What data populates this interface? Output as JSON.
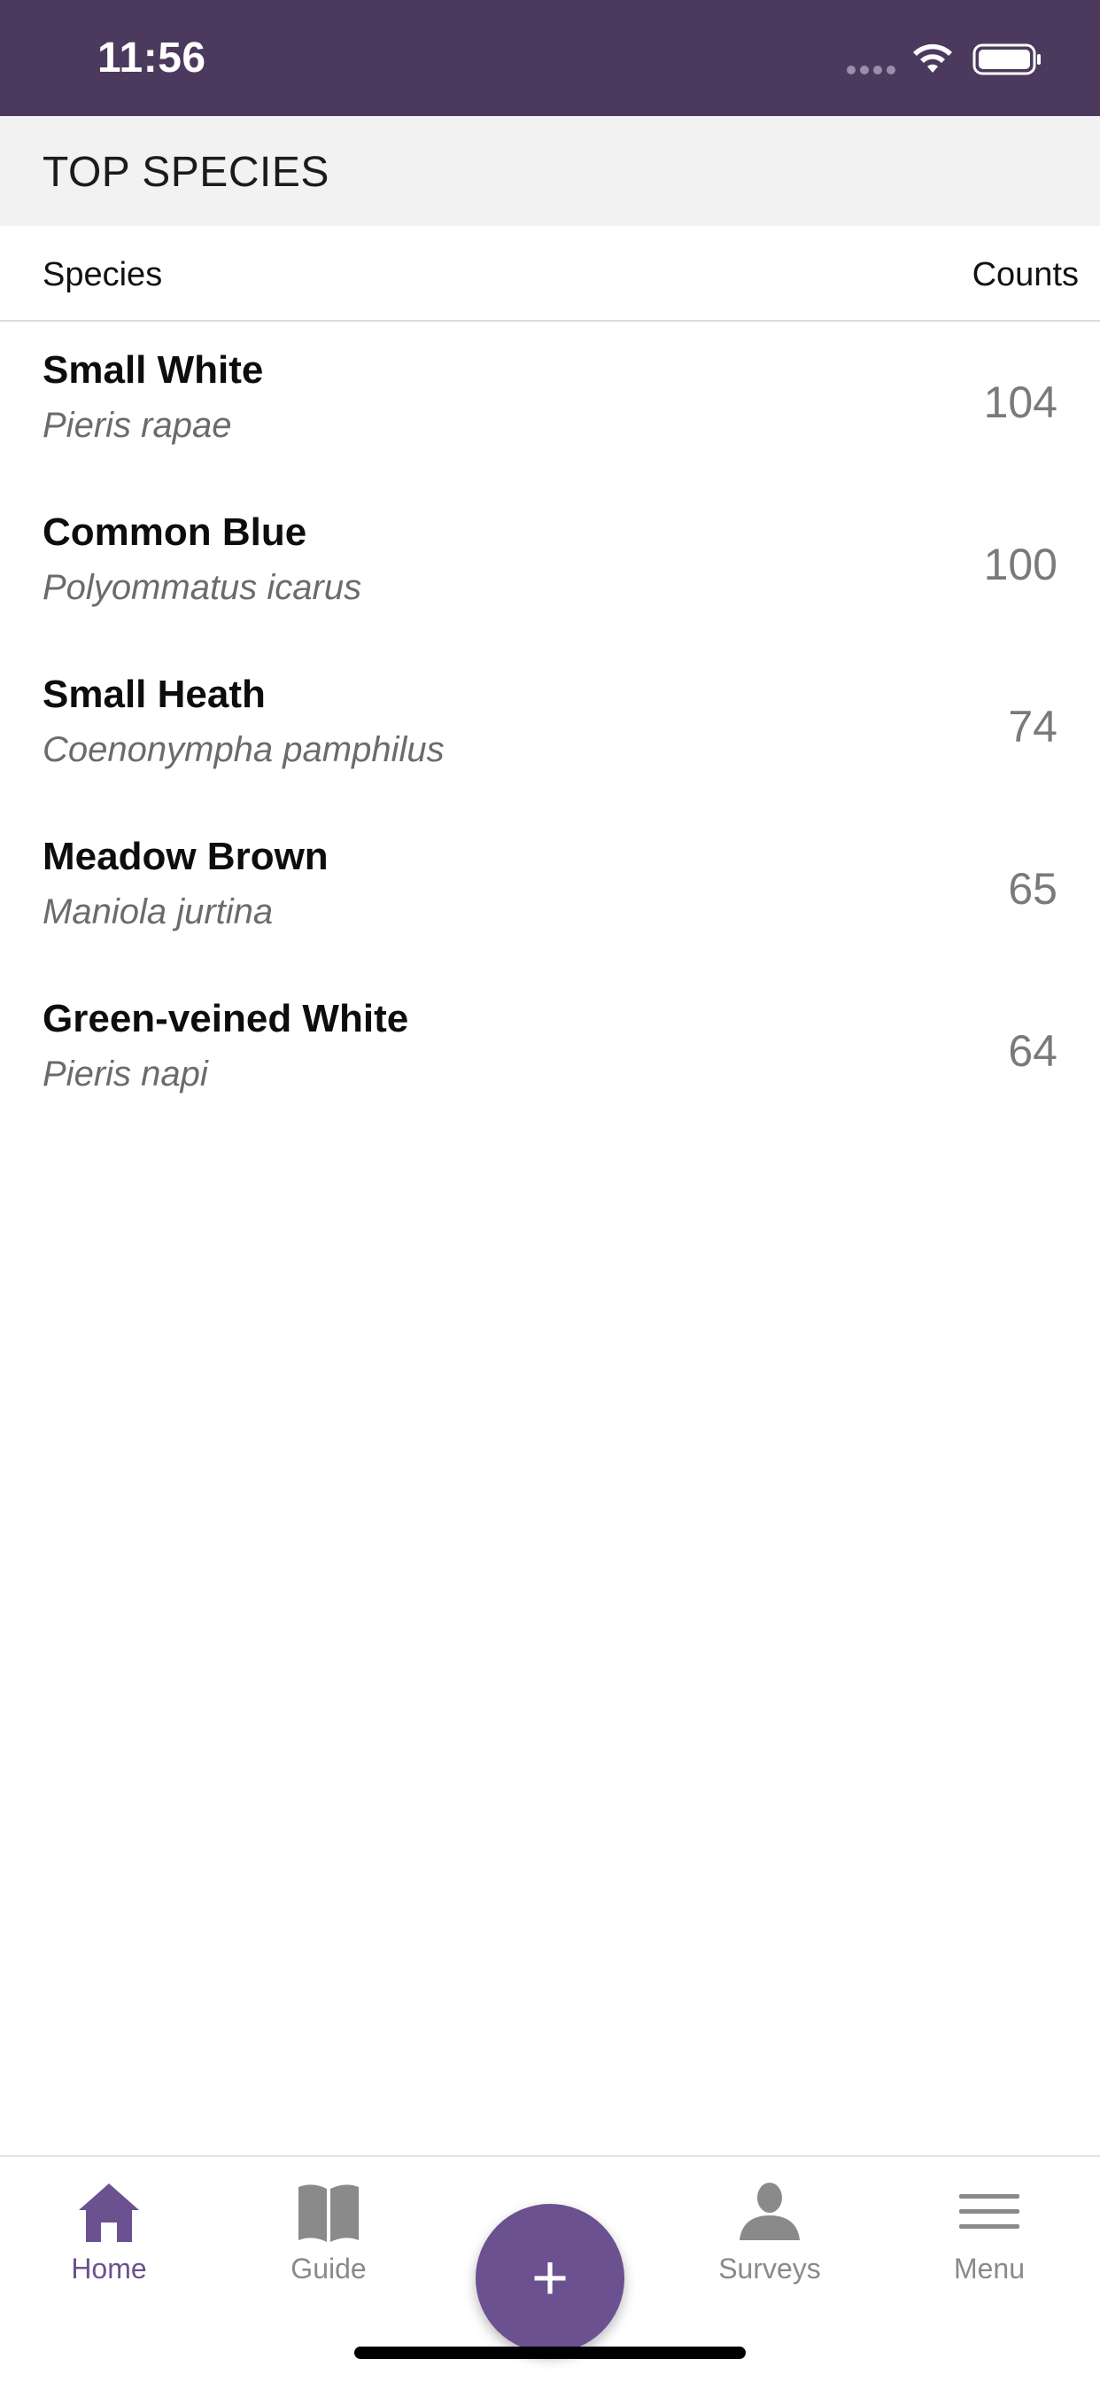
{
  "status_bar": {
    "time": "11:56"
  },
  "section": {
    "title": "TOP SPECIES"
  },
  "columns": {
    "species": "Species",
    "counts": "Counts"
  },
  "species": [
    {
      "name": "Small White",
      "latin": "Pieris rapae",
      "count": "104"
    },
    {
      "name": "Common Blue",
      "latin": "Polyommatus icarus",
      "count": "100"
    },
    {
      "name": "Small Heath",
      "latin": "Coenonympha pamphilus",
      "count": "74"
    },
    {
      "name": "Meadow Brown",
      "latin": "Maniola jurtina",
      "count": "65"
    },
    {
      "name": "Green-veined White",
      "latin": "Pieris napi",
      "count": "64"
    }
  ],
  "tabs": [
    {
      "label": "Home",
      "icon": "home-icon",
      "active": true
    },
    {
      "label": "Guide",
      "icon": "book-icon",
      "active": false
    },
    {
      "label": "Surveys",
      "icon": "person-icon",
      "active": false
    },
    {
      "label": "Menu",
      "icon": "hamburger-menu-icon",
      "active": false
    }
  ],
  "fab": {
    "symbol": "+"
  },
  "colors": {
    "status_bar": "#4c3a5e",
    "accent": "#6b5190",
    "header_bg": "#f2f2f2",
    "inactive_tab": "#8a8a8a"
  }
}
